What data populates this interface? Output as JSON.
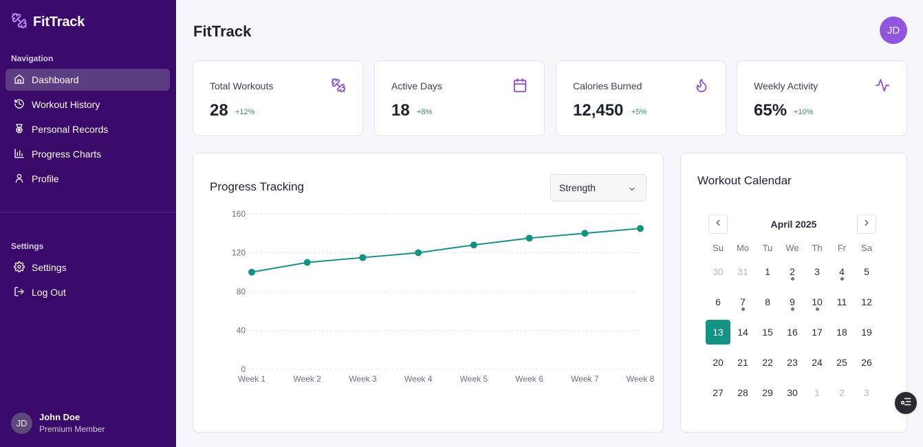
{
  "app": {
    "name": "FitTrack"
  },
  "sidebar": {
    "nav_heading": "Navigation",
    "nav_items": [
      {
        "label": "Dashboard",
        "icon": "home-icon",
        "active": true
      },
      {
        "label": "Workout History",
        "icon": "history-icon"
      },
      {
        "label": "Personal Records",
        "icon": "award-icon"
      },
      {
        "label": "Progress Charts",
        "icon": "bar-chart-icon"
      },
      {
        "label": "Profile",
        "icon": "user-icon"
      }
    ],
    "settings_heading": "Settings",
    "settings_items": [
      {
        "label": "Settings",
        "icon": "gear-icon"
      },
      {
        "label": "Log Out",
        "icon": "logout-icon"
      }
    ],
    "user": {
      "initials": "JD",
      "name": "John Doe",
      "role": "Premium Member"
    }
  },
  "header": {
    "title": "FitTrack",
    "avatar_initials": "JD"
  },
  "stats": [
    {
      "label": "Total Workouts",
      "value": "28",
      "change": "+12%",
      "icon": "dumbbell-icon"
    },
    {
      "label": "Active Days",
      "value": "18",
      "change": "+8%",
      "icon": "calendar-icon"
    },
    {
      "label": "Calories Burned",
      "value": "12,450",
      "change": "+5%",
      "icon": "flame-icon"
    },
    {
      "label": "Weekly Activity",
      "value": "65%",
      "change": "+10%",
      "icon": "activity-icon"
    }
  ],
  "progress": {
    "title": "Progress Tracking",
    "selected_metric": "Strength"
  },
  "chart_data": {
    "type": "line",
    "categories": [
      "Week 1",
      "Week 2",
      "Week 3",
      "Week 4",
      "Week 5",
      "Week 6",
      "Week 7",
      "Week 8"
    ],
    "values": [
      100,
      110,
      115,
      120,
      128,
      135,
      140,
      145
    ],
    "yticks": [
      0,
      40,
      80,
      120,
      160
    ],
    "ylim": [
      0,
      160
    ],
    "grid": true,
    "color": "#129384"
  },
  "calendar": {
    "title": "Workout Calendar",
    "month": "April 2025",
    "weekdays": [
      "Su",
      "Mo",
      "Tu",
      "We",
      "Th",
      "Fr",
      "Sa"
    ],
    "weeks": [
      [
        {
          "d": "30",
          "m": true
        },
        {
          "d": "31",
          "m": true
        },
        {
          "d": "1"
        },
        {
          "d": "2",
          "dot": true
        },
        {
          "d": "3"
        },
        {
          "d": "4",
          "dot": true
        },
        {
          "d": "5"
        }
      ],
      [
        {
          "d": "6"
        },
        {
          "d": "7",
          "dot": true
        },
        {
          "d": "8"
        },
        {
          "d": "9",
          "dot": true
        },
        {
          "d": "10",
          "dot": true
        },
        {
          "d": "11"
        },
        {
          "d": "12"
        }
      ],
      [
        {
          "d": "13",
          "sel": true
        },
        {
          "d": "14"
        },
        {
          "d": "15"
        },
        {
          "d": "16"
        },
        {
          "d": "17"
        },
        {
          "d": "18"
        },
        {
          "d": "19"
        }
      ],
      [
        {
          "d": "20"
        },
        {
          "d": "21"
        },
        {
          "d": "22"
        },
        {
          "d": "23"
        },
        {
          "d": "24"
        },
        {
          "d": "25"
        },
        {
          "d": "26"
        }
      ],
      [
        {
          "d": "27"
        },
        {
          "d": "28"
        },
        {
          "d": "29"
        },
        {
          "d": "30"
        },
        {
          "d": "1",
          "m": true
        },
        {
          "d": "2",
          "m": true
        },
        {
          "d": "3",
          "m": true
        }
      ]
    ]
  },
  "colors": {
    "sidebar": "#3a0a6b",
    "accent": "#129384",
    "positive": "#22a35a",
    "avatar": "#9155e0"
  }
}
